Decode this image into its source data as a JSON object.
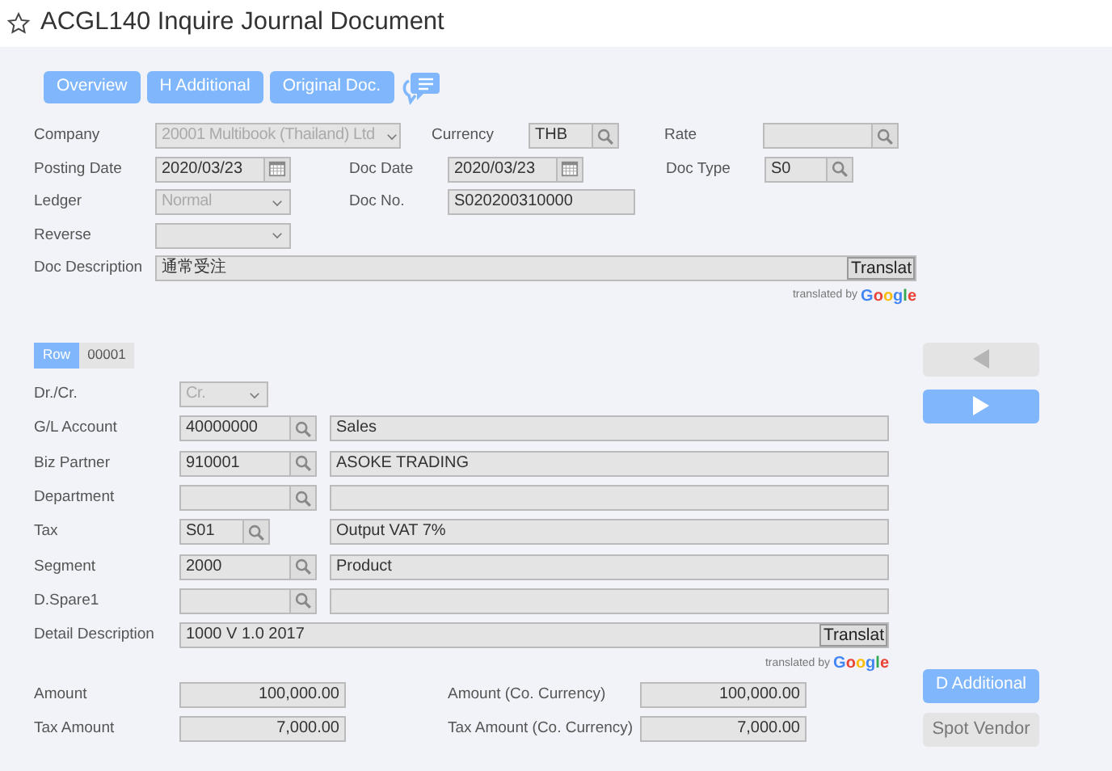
{
  "title": "ACGL140 Inquire Journal Document",
  "header_buttons": [
    {
      "label": "Overview"
    },
    {
      "label": "H Additional"
    },
    {
      "label": "Original Doc."
    }
  ],
  "header_fields": [
    [
      {
        "label": "Company",
        "kind": "select",
        "value": "20001 Multibook (Thailand) Ltd",
        "disabled": true
      },
      {
        "label": "Currency",
        "kind": "lookup",
        "value": "THB"
      },
      {
        "label": "Rate",
        "kind": "lookup"
      }
    ],
    [
      {
        "label": "Posting Date",
        "kind": "date",
        "value": "2020/03/23"
      },
      {
        "label": "Doc Date",
        "kind": "date",
        "value": "2020/03/23"
      },
      {
        "label": "Doc Type",
        "kind": "lookup",
        "value": "S0"
      }
    ],
    [
      {
        "label": "Ledger",
        "kind": "select",
        "value": "Normal",
        "disabled": true
      },
      {
        "label": "Doc No.",
        "kind": "text",
        "value": "S020200310000"
      }
    ],
    [
      {
        "label": "Reverse",
        "kind": "select"
      }
    ],
    [
      {
        "label": "Doc Description",
        "kind": "translate",
        "value": "通常受注",
        "button": "Translat",
        "attribution": "translated by",
        "brand": "Google"
      }
    ]
  ],
  "row_tab": {
    "label": "Row",
    "number": "00001"
  },
  "detail_fields": [
    {
      "label": "Dr./Cr.",
      "kind": "select",
      "value": "Cr.",
      "disabled": true
    },
    {
      "label": "G/L Account",
      "kind": "lookup",
      "value": "40000000",
      "description": "Sales"
    },
    {
      "label": "Biz Partner",
      "kind": "lookup",
      "value": "910001",
      "description": "ASOKE TRADING"
    },
    {
      "label": "Department",
      "kind": "lookup"
    },
    {
      "label": "Tax",
      "kind": "lookup",
      "value": "S01",
      "description": "Output VAT 7%"
    },
    {
      "label": "Segment",
      "kind": "lookup",
      "value": "2000",
      "description": "Product"
    },
    {
      "label": "D.Spare1",
      "kind": "lookup"
    },
    {
      "label": "Detail Description",
      "kind": "translate",
      "value": "1000 V 1.0 2017",
      "button": "Translat",
      "attribution": "translated by",
      "brand": "Google"
    }
  ],
  "amounts": [
    {
      "label": "Amount",
      "value": "100,000.00"
    },
    {
      "label": "Amount (Co. Currency)",
      "value": "100,000.00"
    },
    {
      "label": "Tax Amount",
      "value": "7,000.00"
    },
    {
      "label": "Tax Amount (Co. Currency)",
      "value": "7,000.00"
    }
  ],
  "nav_buttons": [
    {
      "kind": "previous",
      "disabled": true
    },
    {
      "kind": "next",
      "disabled": false
    }
  ],
  "side_buttons": [
    {
      "label": "D Additional",
      "primary": true
    },
    {
      "label": "Spot Vendor",
      "primary": false
    }
  ]
}
